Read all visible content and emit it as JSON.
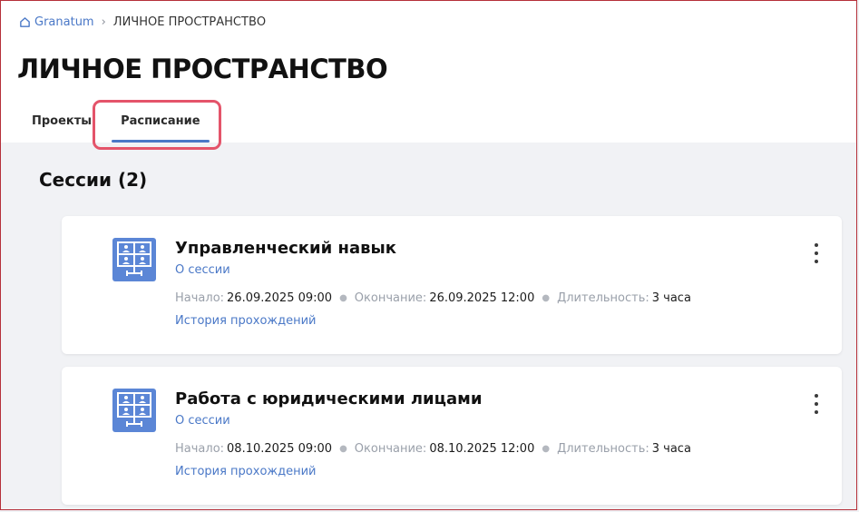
{
  "breadcrumb": {
    "home_label": "Granatum",
    "current": "ЛИЧНОЕ ПРОСТРАНСТВО"
  },
  "page": {
    "title": "ЛИЧНОЕ ПРОСТРАНСТВО"
  },
  "tabs": [
    {
      "label": "Проекты",
      "active": false
    },
    {
      "label": "Расписание",
      "active": true
    }
  ],
  "sessions": {
    "title": "Сессии (2)",
    "items": [
      {
        "title": "Управленческий навык",
        "about_link": "О сессии",
        "start_label": "Начало:",
        "start_value": "26.09.2025 09:00",
        "end_label": "Окончание:",
        "end_value": "26.09.2025 12:00",
        "duration_label": "Длительность:",
        "duration_value": "3 часа",
        "history_link": "История прохождений"
      },
      {
        "title": "Работа с юридическими лицами",
        "about_link": "О сессии",
        "start_label": "Начало:",
        "start_value": "08.10.2025 09:00",
        "end_label": "Окончание:",
        "end_value": "08.10.2025 12:00",
        "duration_label": "Длительность:",
        "duration_value": "3 часа",
        "history_link": "История прохождений"
      }
    ]
  },
  "icons": {
    "home": "home-icon",
    "session": "video-conference-icon",
    "more": "more-vertical-icon"
  },
  "colors": {
    "accent": "#4a78c7",
    "icon_bg": "#5b86d6",
    "highlight": "#e4546a",
    "page_bg": "#f1f2f5"
  }
}
